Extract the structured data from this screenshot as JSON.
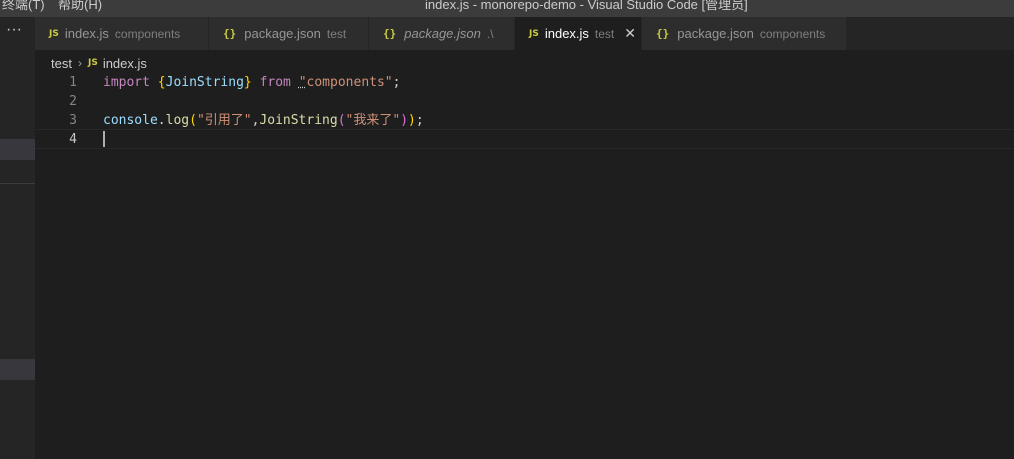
{
  "titlebar": {
    "menu": [
      "终端(T)",
      "帮助(H)"
    ],
    "title": "index.js - monorepo-demo - Visual Studio Code [管理员]"
  },
  "sidebar": {
    "more_label": "···"
  },
  "tabs": [
    {
      "icon": "JS",
      "name": "index.js",
      "desc": "components",
      "active": false,
      "italic": false
    },
    {
      "icon": "{}",
      "name": "package.json",
      "desc": "test",
      "active": false,
      "italic": false
    },
    {
      "icon": "{}",
      "name": "package.json",
      "desc": ".\\",
      "active": false,
      "italic": true
    },
    {
      "icon": "JS",
      "name": "index.js",
      "desc": "test",
      "active": true,
      "italic": false,
      "close": "✕"
    },
    {
      "icon": "{}",
      "name": "package.json",
      "desc": "components",
      "active": false,
      "italic": false
    }
  ],
  "breadcrumb": {
    "folder": "test",
    "chevron": "›",
    "icon": "JS",
    "file": "index.js"
  },
  "editor": {
    "line_numbers": [
      "1",
      "2",
      "3",
      "4"
    ],
    "line1": {
      "kw_import": "import",
      "brace_open": "{",
      "ident": "JoinString",
      "brace_close": "}",
      "kw_from": "from",
      "quote_open": "\"",
      "module": "components\"",
      "semi": ";"
    },
    "line3": {
      "obj": "console",
      "dot": ".",
      "method": "log",
      "paren_open": "(",
      "str1": "\"引用了\"",
      "comma": ",",
      "fn": "JoinString",
      "paren2_open": "(",
      "str2": "\"我来了\"",
      "paren2_close": ")",
      "paren_close": ")",
      "semi": ";"
    }
  },
  "colors": {
    "editor_bg": "#1e1e1e",
    "tab_inactive": "#2d2d2d",
    "keyword": "#c586c0",
    "variable": "#9cdcfe",
    "function": "#dcdcaa",
    "string": "#ce9178",
    "js_icon": "#cbcb41"
  }
}
